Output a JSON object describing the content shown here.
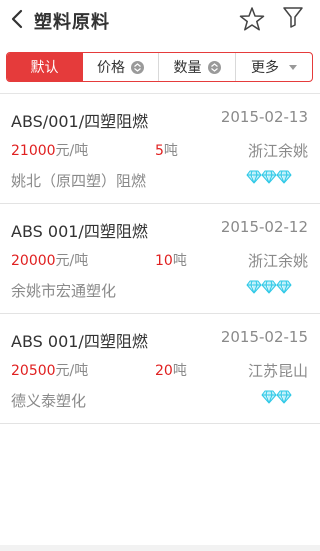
{
  "header": {
    "title": "塑料原料",
    "back_icon": "chevron-left-icon",
    "favorite_icon": "star-outline-icon",
    "filter_icon": "filter-funnel-icon"
  },
  "tabs": [
    {
      "label": "默认",
      "active": true
    },
    {
      "label": "价格",
      "icon": "sort-circle-icon"
    },
    {
      "label": "数量",
      "icon": "sort-circle-icon"
    },
    {
      "label": "更多",
      "icon": "caret-down-icon"
    }
  ],
  "listings": [
    {
      "name": "ABS/001/四塑阻燃",
      "date": "2015-02-13",
      "price": "21000",
      "price_unit": "元/吨",
      "quantity": "5",
      "quantity_unit": "吨",
      "location": "浙江余姚",
      "company": "姚北（原四塑）阻燃",
      "rating_diamonds": 3
    },
    {
      "name": "ABS 001/四塑阻燃",
      "date": "2015-02-12",
      "price": "20000",
      "price_unit": "元/吨",
      "quantity": "10",
      "quantity_unit": "吨",
      "location": "浙江余姚",
      "company": "余姚市宏通塑化",
      "rating_diamonds": 3
    },
    {
      "name": "ABS 001/四塑阻燃",
      "date": "2015-02-15",
      "price": "20500",
      "price_unit": "元/吨",
      "quantity": "20",
      "quantity_unit": "吨",
      "location": "江苏昆山",
      "company": "德义泰塑化",
      "rating_diamonds": 2
    }
  ],
  "colors": {
    "accent": "#e53b3b",
    "price_red": "#e02020",
    "secondary_text": "#8a8a8a",
    "diamond": "#2ec8e6"
  }
}
